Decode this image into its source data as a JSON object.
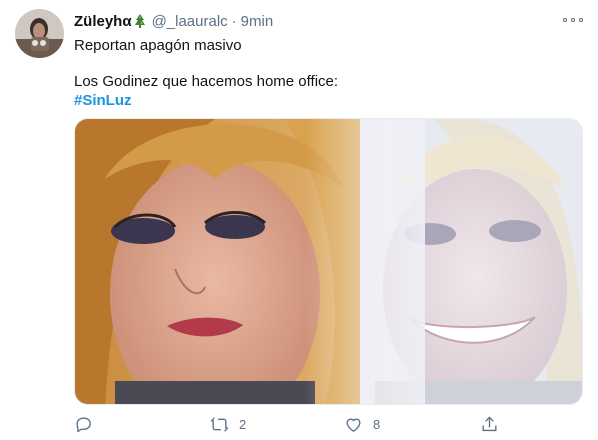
{
  "tweet": {
    "author": {
      "display_name": "Züleyhα",
      "handle": "@_laauralc",
      "separator": "·",
      "time": "9min"
    },
    "text_line_1": "Reportan apagón masivo",
    "text_line_2": "Los Godinez que hacemos home office:",
    "hashtag": "#SinLuz",
    "actions": {
      "replies": "",
      "retweets": "2",
      "likes": "8"
    }
  },
  "colors": {
    "link": "#1b95e0",
    "secondary_text": "#5b7083",
    "primary_text": "#0f1419"
  },
  "icons": {
    "avatar_badge": "christmas-tree-icon",
    "more": "more-icon",
    "reply": "reply-icon",
    "retweet": "retweet-icon",
    "like": "heart-icon",
    "share": "share-icon"
  }
}
